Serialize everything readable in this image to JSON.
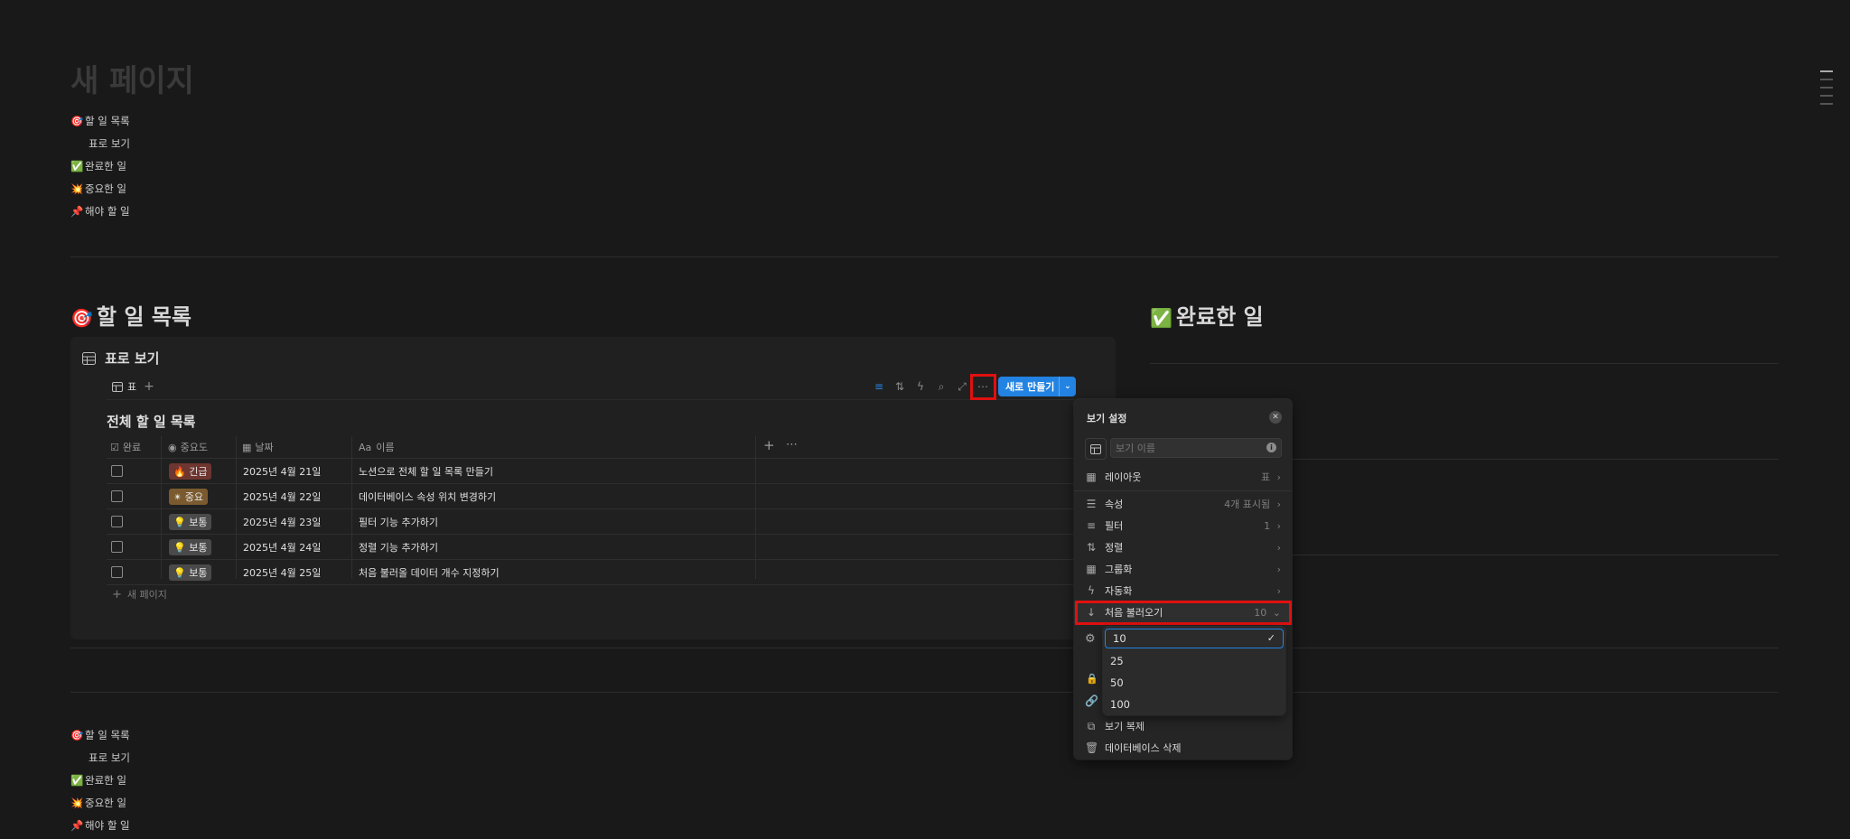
{
  "page": {
    "title": "새 페이지"
  },
  "toc": [
    {
      "emoji": "🎯",
      "label": "할 일 목록",
      "sub": false
    },
    {
      "emoji": "",
      "label": "표로 보기",
      "sub": true
    },
    {
      "emoji": "✅",
      "label": "완료한 일",
      "sub": false
    },
    {
      "emoji": "💥",
      "label": "중요한 일",
      "sub": false
    },
    {
      "emoji": "📌",
      "label": "해야 할 일",
      "sub": false
    }
  ],
  "section_todo": {
    "emoji": "🎯",
    "title": "할 일 목록"
  },
  "section_done": {
    "emoji": "✅",
    "title": "완료한 일"
  },
  "database": {
    "view_title": "표로 보기",
    "tab_label": "표",
    "table_title": "전체 할 일 목록",
    "new_button": "새로 만들기",
    "new_page": "새 페이지",
    "columns": [
      {
        "icon": "☑",
        "label": "완료"
      },
      {
        "icon": "◉",
        "label": "중요도"
      },
      {
        "icon": "▦",
        "label": "날짜"
      },
      {
        "icon": "Aa",
        "label": "이름"
      }
    ],
    "rows": [
      {
        "priority": "🔥 긴급",
        "priority_style": "red",
        "date": "2025년 4월 21일",
        "name": "노션으로 전체 할 일 목록 만들기"
      },
      {
        "priority": "✴ 중요",
        "priority_style": "brown",
        "date": "2025년 4월 22일",
        "name": "데이터베이스 속성 위치 변경하기"
      },
      {
        "priority": "💡 보통",
        "priority_style": "gray",
        "date": "2025년 4월 23일",
        "name": "필터 기능 추가하기"
      },
      {
        "priority": "💡 보통",
        "priority_style": "gray",
        "date": "2025년 4월 24일",
        "name": "정렬 기능 추가하기"
      },
      {
        "priority": "💡 보통",
        "priority_style": "gray",
        "date": "2025년 4월 25일",
        "name": "처음 불러올 데이터 개수 지정하기"
      }
    ]
  },
  "view_settings": {
    "title": "보기 설정",
    "name_placeholder": "보기 이름",
    "items": [
      {
        "icon": "▦",
        "label": "레이아웃",
        "value": "표"
      },
      {
        "icon": "☰",
        "label": "속성",
        "value": "4개 표시됨"
      },
      {
        "icon": "≡",
        "label": "필터",
        "value": "1"
      },
      {
        "icon": "⇅",
        "label": "정렬",
        "value": ""
      },
      {
        "icon": "▦",
        "label": "그룹화",
        "value": ""
      },
      {
        "icon": "ϟ",
        "label": "자동화",
        "value": ""
      },
      {
        "icon": "↓",
        "label": "처음 불러오기",
        "value": "10"
      }
    ],
    "load_options": [
      "10",
      "25",
      "50",
      "100"
    ],
    "selected_option": "10",
    "bottom_items": [
      {
        "icon": "⧉",
        "label": "보기 복제"
      },
      {
        "icon": "🗑",
        "label": "데이터베이스 삭제"
      }
    ]
  },
  "colors": {
    "background": "#191919",
    "accent": "#2383e2",
    "highlight": "#e01010"
  }
}
